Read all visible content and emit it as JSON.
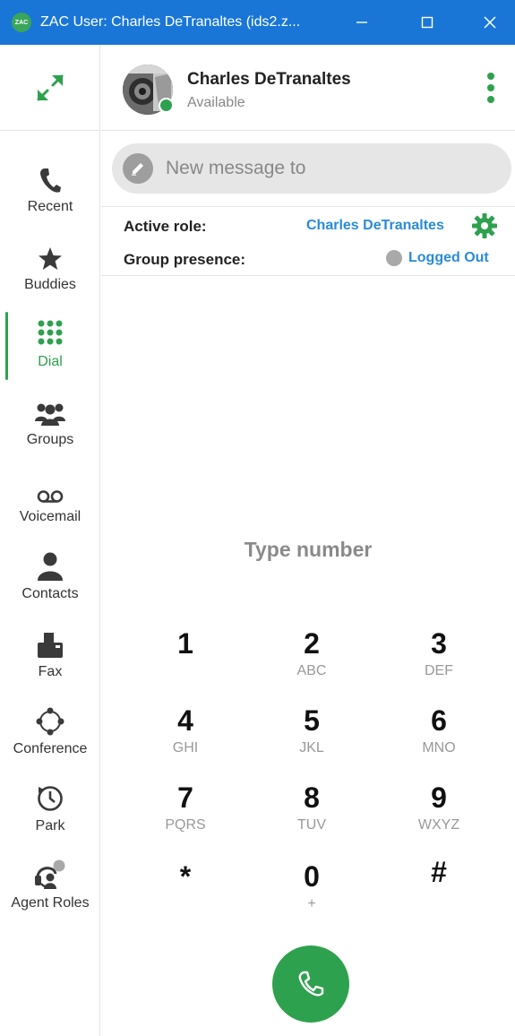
{
  "window": {
    "title": "ZAC User: Charles DeTranaltes (ids2.z...",
    "app_icon_text": "ZAC",
    "controls": [
      "minimize-icon",
      "maximize-icon",
      "close-icon"
    ]
  },
  "sidebar": {
    "expand_icon": "expand-arrows-icon",
    "active_index": 2,
    "items": [
      {
        "label": "Recent",
        "icon": "phone-icon"
      },
      {
        "label": "Buddies",
        "icon": "star-icon"
      },
      {
        "label": "Dial",
        "icon": "dialpad-icon"
      },
      {
        "label": "Groups",
        "icon": "group-icon"
      },
      {
        "label": "Voicemail",
        "icon": "voicemail-icon"
      },
      {
        "label": "Contacts",
        "icon": "person-icon"
      },
      {
        "label": "Fax",
        "icon": "fax-icon"
      },
      {
        "label": "Conference",
        "icon": "conference-icon"
      },
      {
        "label": "Park",
        "icon": "clock-icon"
      },
      {
        "label": "Agent Roles",
        "icon": "headset-icon"
      }
    ]
  },
  "user": {
    "name": "Charles DeTranaltes",
    "status": "Available",
    "status_color": "#2ea14f"
  },
  "message": {
    "placeholder": "New message to"
  },
  "role": {
    "active_role_label": "Active role:",
    "active_role_value": "Charles DeTranaltes",
    "group_presence_label": "Group presence:",
    "group_presence_value": "Logged Out"
  },
  "dialpad": {
    "prompt": "Type number",
    "keys": [
      {
        "digit": "1",
        "letters": ""
      },
      {
        "digit": "2",
        "letters": "ABC"
      },
      {
        "digit": "3",
        "letters": "DEF"
      },
      {
        "digit": "4",
        "letters": "GHI"
      },
      {
        "digit": "5",
        "letters": "JKL"
      },
      {
        "digit": "6",
        "letters": "MNO"
      },
      {
        "digit": "7",
        "letters": "PQRS"
      },
      {
        "digit": "8",
        "letters": "TUV"
      },
      {
        "digit": "9",
        "letters": "WXYZ"
      },
      {
        "digit": "*",
        "letters": ""
      },
      {
        "digit": "0",
        "letters": "+"
      },
      {
        "digit": "#",
        "letters": ""
      }
    ],
    "call_icon": "call-icon"
  },
  "colors": {
    "titlebar": "#1976d6",
    "accent_green": "#2ea14f",
    "link_blue": "#2a8bd6"
  }
}
